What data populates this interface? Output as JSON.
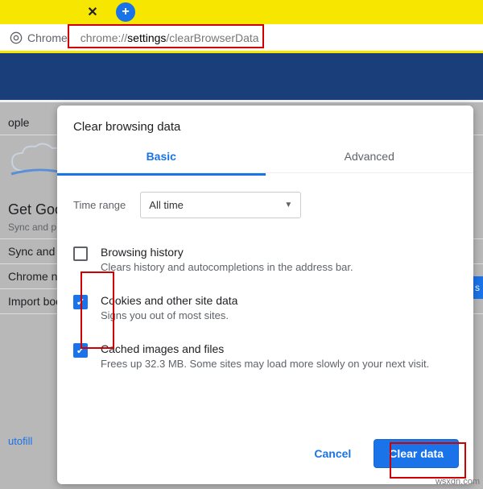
{
  "tabbar": {
    "close_glyph": "✕",
    "plus_glyph": "+"
  },
  "omnibox": {
    "chip_label": "Chrome",
    "url_prefix": "chrome://",
    "url_mid": "settings",
    "url_suffix": "/clearBrowserData"
  },
  "background": {
    "people_heading": "ople",
    "get_google": "Get Goo",
    "get_google_sub": "Sync and p",
    "sync_google": "Sync and G",
    "chrome_name": "Chrome na",
    "import_book": "Import boo",
    "sidebar_autofill": "utofill",
    "blue_chip": "n s"
  },
  "dialog": {
    "title": "Clear browsing data",
    "tabs": {
      "basic": "Basic",
      "advanced": "Advanced"
    },
    "time_range_label": "Time range",
    "time_range_value": "All time",
    "options": [
      {
        "key": "history",
        "checked": false,
        "title": "Browsing history",
        "desc": "Clears history and autocompletions in the address bar."
      },
      {
        "key": "cookies",
        "checked": true,
        "title": "Cookies and other site data",
        "desc": "Signs you out of most sites."
      },
      {
        "key": "cache",
        "checked": true,
        "title": "Cached images and files",
        "desc": "Frees up 32.3 MB. Some sites may load more slowly on your next visit."
      }
    ],
    "cancel": "Cancel",
    "confirm": "Clear data"
  },
  "watermark": "wsxdn.com"
}
